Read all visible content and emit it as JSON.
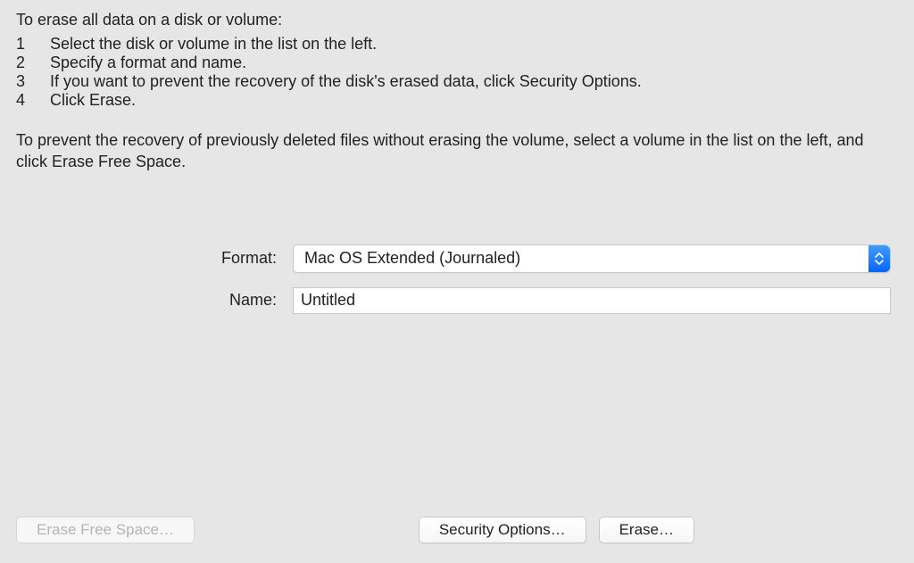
{
  "intro": "To erase all data on a disk or volume:",
  "steps": [
    {
      "n": "1",
      "text": "Select the disk or volume in the list on the left."
    },
    {
      "n": "2",
      "text": "Specify a format and name."
    },
    {
      "n": "3",
      "text": "If you want to prevent the recovery of the disk's erased data, click Security Options."
    },
    {
      "n": "4",
      "text": "Click Erase."
    }
  ],
  "note": "To prevent the recovery of previously deleted files without erasing the volume, select a volume in the list on the left, and click Erase Free Space.",
  "form": {
    "format_label": "Format:",
    "format_value": "Mac OS Extended (Journaled)",
    "name_label": "Name:",
    "name_value": "Untitled"
  },
  "buttons": {
    "erase_free_space": "Erase Free Space…",
    "security_options": "Security Options…",
    "erase": "Erase…"
  }
}
